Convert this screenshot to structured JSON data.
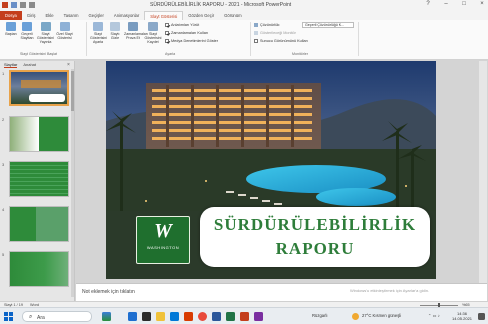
{
  "window": {
    "title": "SÜRDÜRÜLEBİLİRLİK RAPORU - 2021 - Microsoft PowerPoint",
    "controls": [
      "?",
      "–",
      "□",
      "×"
    ]
  },
  "ribbon": {
    "tabs": [
      "Dosya",
      "Giriş",
      "Ekle",
      "Tasarım",
      "Geçişler",
      "Animasyonlar",
      "Slayt Gösterisi",
      "Gözden Geçir",
      "Görünüm"
    ],
    "active_tab": "Slayt Gösterisi",
    "buttons": [
      {
        "label": "Baştan",
        "icon": "play-start-icon"
      },
      {
        "label": "Geçerli Slayttan",
        "icon": "play-current-icon"
      },
      {
        "label": "Slayt Gösterisini Yayınla",
        "icon": "broadcast-icon"
      },
      {
        "label": "Özel Slayt Gösterisi",
        "icon": "custom-show-icon"
      },
      {
        "label": "Slayt Gösterisini Ayarla",
        "icon": "setup-show-icon"
      },
      {
        "label": "Slaytı Gizle",
        "icon": "hide-slide-icon"
      },
      {
        "label": "Zamanlamaları Prova Et",
        "icon": "rehearse-icon"
      },
      {
        "label": "Slayt Gösterisini Kaydet",
        "icon": "record-icon"
      }
    ],
    "group_labels": [
      "Slayt Gösterisini Başlat",
      "Ayarla",
      "Monitörler"
    ],
    "checkboxes": [
      {
        "label": "Anlatımları Yürüt",
        "checked": true
      },
      {
        "label": "Zamanlamaları Kullan",
        "checked": true
      },
      {
        "label": "Medya Denetimlerini Göster",
        "checked": true
      },
      {
        "label": "Çözünürlük:",
        "checked": false
      },
      {
        "label": "Sunucu Görünümünü Kullan",
        "checked": false
      }
    ],
    "resolution_value": "Geçerli Çözünürlüğü K...",
    "show_on_value": "Gösterileceği Monitör"
  },
  "panel": {
    "tabs": [
      "Slaytlar",
      "Anahat"
    ],
    "close": "×",
    "slide_numbers": [
      "1",
      "2",
      "3",
      "4",
      "5"
    ]
  },
  "slide": {
    "title_line1": "SÜRDÜRÜLEBİLİRLİK",
    "title_line2": "RAPORU",
    "logo_text": "WASHINGTON",
    "colors": {
      "title": "#2e7d3a",
      "banner_bg": "#ffffff"
    }
  },
  "notes": {
    "placeholder": "Not eklemek için tıklatın",
    "watermark": "Windows'u etkinleştirmek için Ayarlar'a gidin."
  },
  "status": {
    "slide_info": "Slayt 1 / 19",
    "theme": "Word",
    "zoom": "%65"
  },
  "taskbar": {
    "search_placeholder": "Ara",
    "weather": "Rüzgarlı",
    "temp": "27°C  Kısmen güneşli",
    "time": "14:36",
    "date": "14.05.2021"
  }
}
